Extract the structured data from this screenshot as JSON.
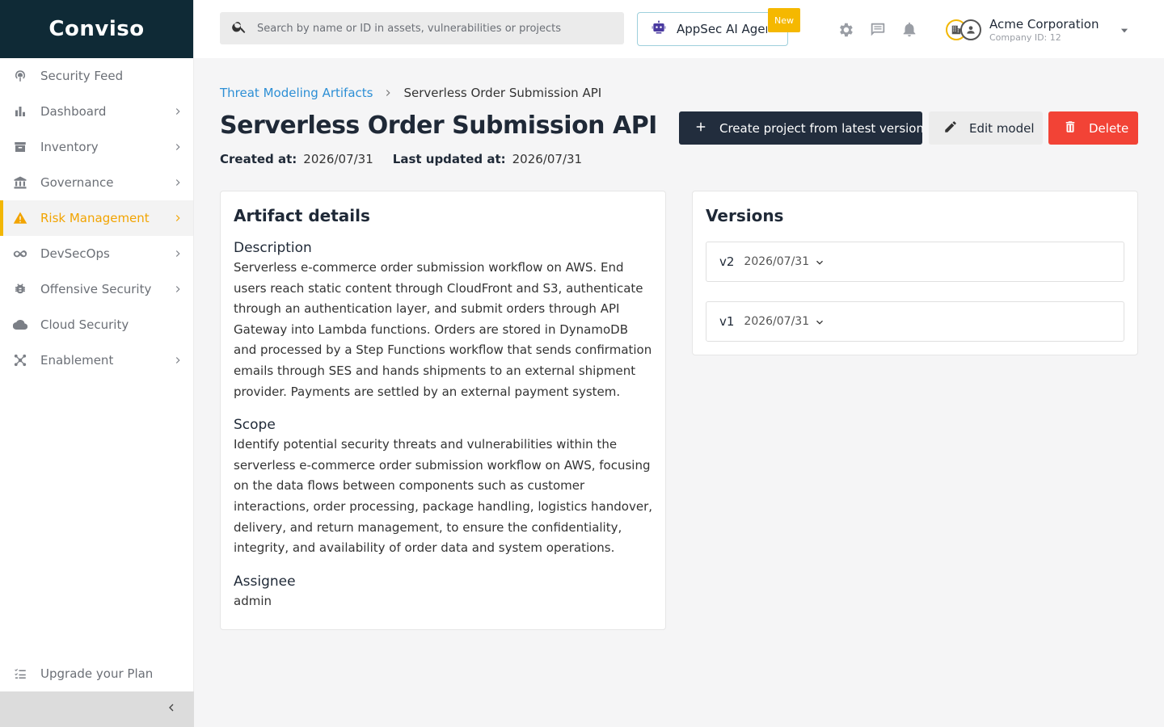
{
  "brand": {
    "logo_text": "Conviso"
  },
  "sidebar": {
    "items": [
      {
        "label": "Security Feed",
        "icon": "broadcast-icon",
        "has_children": false,
        "active": false
      },
      {
        "label": "Dashboard",
        "icon": "bar-chart-icon",
        "has_children": true,
        "active": false
      },
      {
        "label": "Inventory",
        "icon": "inventory-icon",
        "has_children": true,
        "active": false
      },
      {
        "label": "Governance",
        "icon": "bank-icon",
        "has_children": true,
        "active": false
      },
      {
        "label": "Risk Management",
        "icon": "warning-icon",
        "has_children": true,
        "active": true
      },
      {
        "label": "DevSecOps",
        "icon": "infinity-icon",
        "has_children": true,
        "active": false
      },
      {
        "label": "Offensive Security",
        "icon": "bug-icon",
        "has_children": true,
        "active": false
      },
      {
        "label": "Cloud Security",
        "icon": "cloud-icon",
        "has_children": false,
        "active": false
      },
      {
        "label": "Enablement",
        "icon": "network-icon",
        "has_children": true,
        "active": false
      }
    ],
    "upgrade_label": "Upgrade your Plan",
    "active_color": "#f2a400"
  },
  "header": {
    "search_placeholder": "Search by name or ID in assets, vulnerabilities or projects",
    "agent_label": "AppSec AI Agent",
    "new_badge": "New",
    "company_name": "Acme Corporation",
    "company_id": "Company ID: 12"
  },
  "breadcrumb": {
    "parent": "Threat Modeling Artifacts",
    "current": "Serverless Order Submission API"
  },
  "page": {
    "title": "Serverless Order Submission API",
    "created_label": "Created at:",
    "created_value": "2026/07/31",
    "updated_label": "Last updated at:",
    "updated_value": "2026/07/31"
  },
  "actions": {
    "create_label": "Create project from latest version",
    "edit_label": "Edit model",
    "delete_label": "Delete",
    "delete_color": "#f24336",
    "create_color": "#222d3d"
  },
  "details": {
    "title": "Artifact details",
    "description_label": "Description",
    "description": "Serverless e-commerce order submission workflow on AWS. End users reach static content through CloudFront and S3, authenticate through an authentication layer, and submit orders through API Gateway into Lambda functions. Orders are stored in DynamoDB and processed by a Step Functions workflow that sends confirmation emails through SES and hands shipments to an external shipment provider. Payments are settled by an external payment system.",
    "scope_label": "Scope",
    "scope": "Identify potential security threats and vulnerabilities within the serverless e-commerce order submission workflow on AWS, focusing on the data flows between components such as customer interactions, order processing, package handling, logistics handover, delivery, and return management, to ensure the confidentiality, integrity, and availability of order data and system operations.",
    "assignee_label": "Assignee",
    "assignee": "admin"
  },
  "versions": {
    "title": "Versions",
    "items": [
      {
        "name": "v2",
        "date": "2026/07/31"
      },
      {
        "name": "v1",
        "date": "2026/07/31"
      }
    ]
  }
}
